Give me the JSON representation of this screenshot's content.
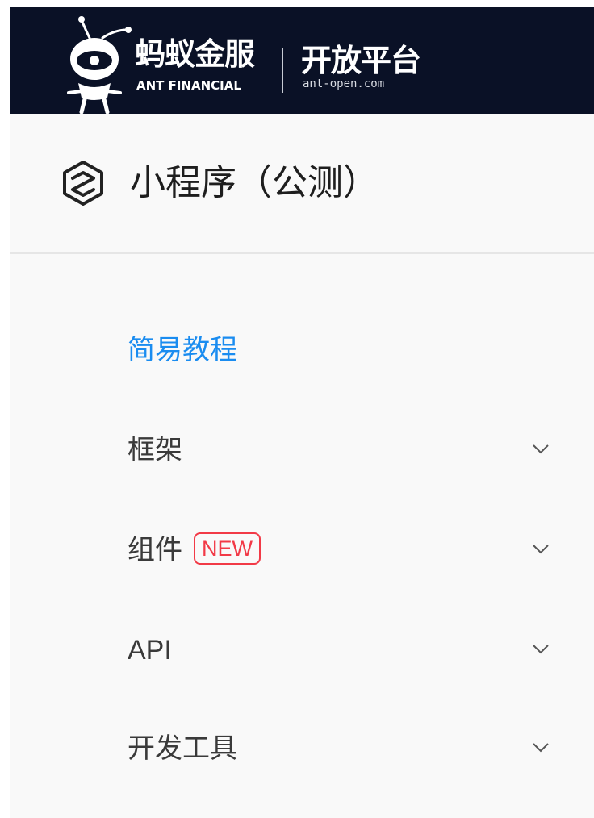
{
  "header": {
    "brand_cn": "蚂蚁金服",
    "brand_en": "ANT FINANCIAL",
    "platform_cn": "开放平台",
    "platform_url": "ant-open.com"
  },
  "product": {
    "title": "小程序（公测）",
    "icon": "hexagon-logo-icon"
  },
  "nav": {
    "items": [
      {
        "label": "简易教程",
        "active": true
      },
      {
        "label": "框架",
        "expandable": true
      },
      {
        "label": "组件",
        "badge": "NEW",
        "expandable": true
      },
      {
        "label": "API",
        "expandable": true
      },
      {
        "label": "开发工具",
        "expandable": true
      }
    ]
  },
  "colors": {
    "header_bg": "#0a1126",
    "active": "#1a8cf0",
    "badge": "#f23a47"
  }
}
